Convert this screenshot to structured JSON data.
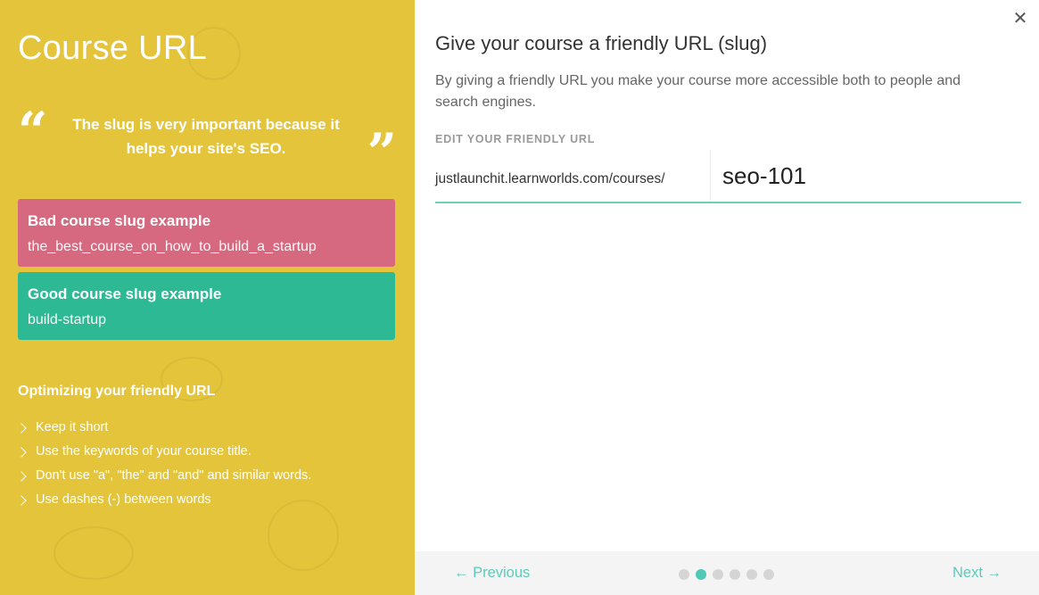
{
  "left_panel": {
    "title": "Course URL",
    "quote": {
      "open_mark": "“",
      "text": "The slug is very important because it helps your site's SEO.",
      "close_mark": "”"
    },
    "bad_example": {
      "title": "Bad course slug example",
      "value": "the_best_course_on_how_to_build_a_startup",
      "color": "#D6687F"
    },
    "good_example": {
      "title": "Good course slug example",
      "value": "build-startup",
      "color": "#2EB995"
    },
    "tips": {
      "title": "Optimizing your friendly URL",
      "items": [
        "Keep it short",
        "Use the keywords of your course title.",
        "Don't use \"a\", \"the\" and \"and\" and similar words.",
        "Use dashes (-) between words"
      ]
    },
    "background_color": "#E3C43B"
  },
  "right_panel": {
    "close_icon": "✕",
    "title": "Give your course a friendly URL (slug)",
    "description": "By giving a friendly URL you make your course more accessible both to people and search engines.",
    "field_label": "EDIT YOUR FRIENDLY URL",
    "url_prefix": "justlaunchit.learnworlds.com/courses/",
    "slug_value": "seo-101",
    "accent_color": "#5ECBB9"
  },
  "footer": {
    "previous_label": "← Previous",
    "next_label": "Next →",
    "steps_total": 6,
    "current_step": 2
  }
}
